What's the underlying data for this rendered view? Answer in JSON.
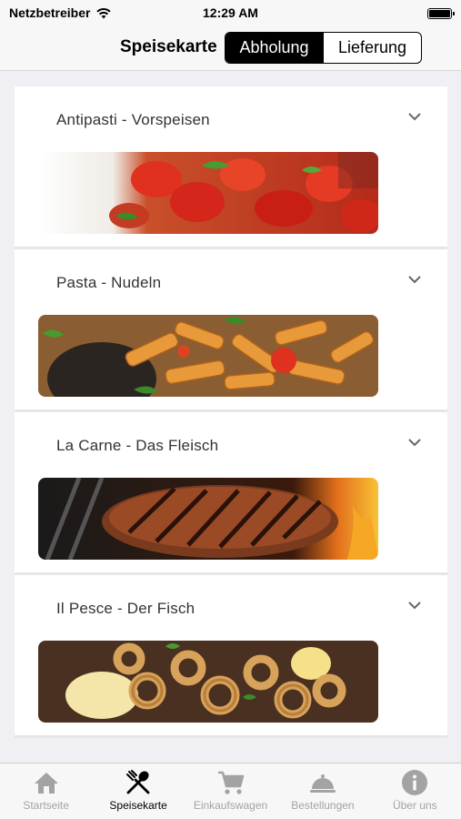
{
  "status_bar": {
    "carrier": "Netzbetreiber",
    "time": "12:29 AM"
  },
  "nav": {
    "title": "Speisekarte",
    "segments": [
      {
        "label": "Abholung",
        "selected": true
      },
      {
        "label": "Lieferung",
        "selected": false
      }
    ]
  },
  "menu": {
    "categories": [
      {
        "title": "Antipasti - Vorspeisen",
        "image": "tomato-bruschetta"
      },
      {
        "title": "Pasta - Nudeln",
        "image": "penne-pasta"
      },
      {
        "title": "La Carne - Das Fleisch",
        "image": "grilled-steak"
      },
      {
        "title": "Il Pesce - Der Fisch",
        "image": "fried-calamari"
      }
    ]
  },
  "tab_bar": {
    "items": [
      {
        "label": "Startseite",
        "icon": "house-icon",
        "active": false
      },
      {
        "label": "Speisekarte",
        "icon": "fork-spoon-icon",
        "active": true
      },
      {
        "label": "Einkaufswagen",
        "icon": "cart-icon",
        "active": false
      },
      {
        "label": "Bestellungen",
        "icon": "cloche-icon",
        "active": false
      },
      {
        "label": "Über uns",
        "icon": "info-icon",
        "active": false
      }
    ]
  },
  "colors": {
    "accent": "#000000",
    "inactive": "#a3a3a3",
    "background": "#efeff4"
  }
}
